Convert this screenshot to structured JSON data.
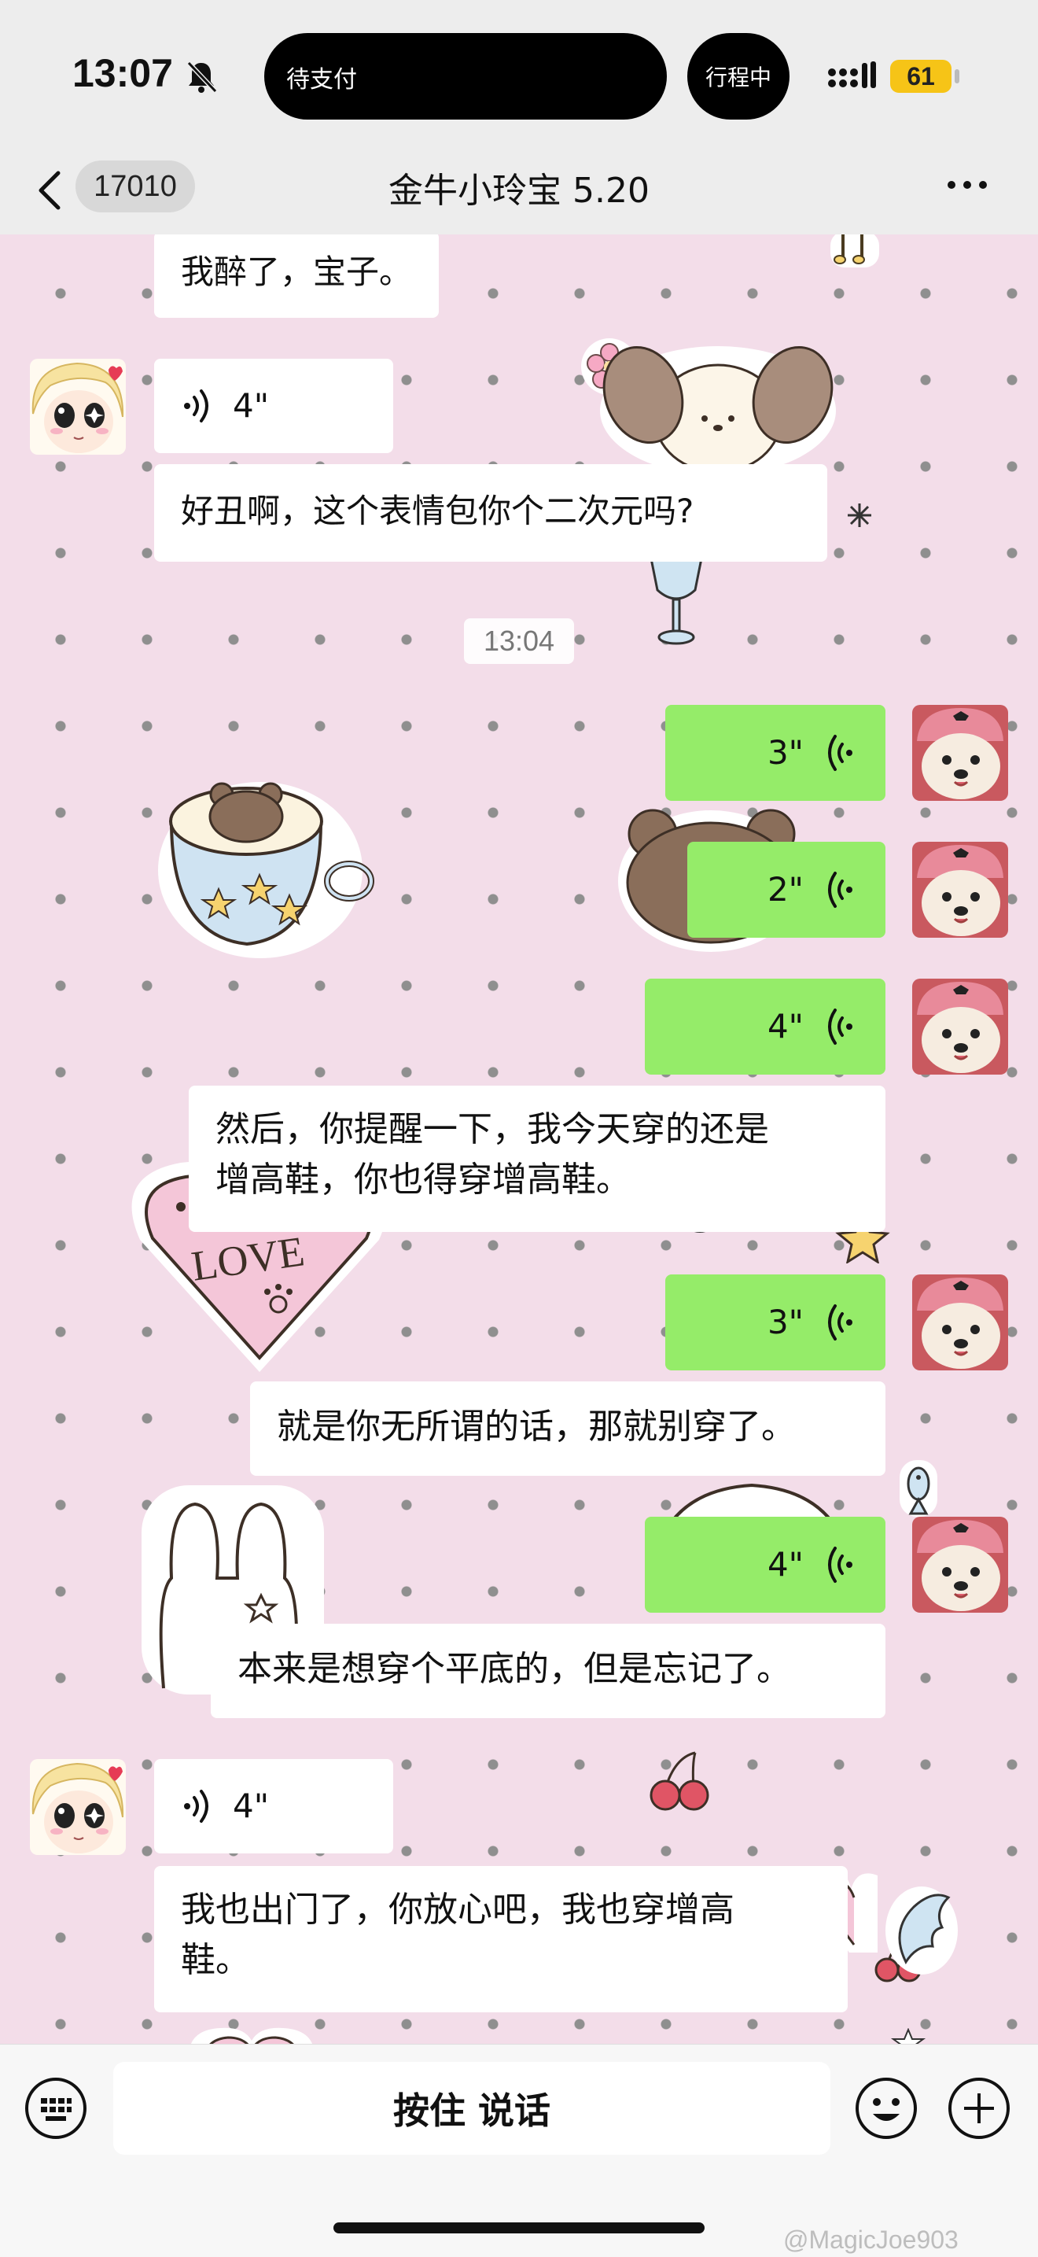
{
  "status_bar": {
    "time": "13:07",
    "pending_label": "待支付",
    "trip_label": "行程中",
    "battery": "61"
  },
  "nav": {
    "unread_count": "17010",
    "title": "金牛小玲宝 5.20"
  },
  "messages": [
    {
      "side": "in",
      "type": "text",
      "text": "我醉了，宝子。"
    },
    {
      "side": "in",
      "type": "voice",
      "duration": "4\""
    },
    {
      "side": "in",
      "type": "text",
      "text": "好丑啊，这个表情包你个二次元吗?"
    },
    {
      "type": "time",
      "text": "13:04"
    },
    {
      "side": "out",
      "type": "voice",
      "duration": "3\""
    },
    {
      "side": "out",
      "type": "voice",
      "duration": "2\""
    },
    {
      "side": "out",
      "type": "voice",
      "duration": "4\""
    },
    {
      "side": "out",
      "type": "text",
      "lines": [
        "然后，你提醒一下，我今天穿的还是",
        "增高鞋，你也得穿增高鞋。"
      ]
    },
    {
      "side": "out",
      "type": "voice",
      "duration": "3\""
    },
    {
      "side": "out",
      "type": "text",
      "text": "就是你无所谓的话，那就别穿了。"
    },
    {
      "side": "out",
      "type": "voice",
      "duration": "4\""
    },
    {
      "side": "out",
      "type": "text",
      "text": "本来是想穿个平底的，但是忘记了。"
    },
    {
      "side": "in",
      "type": "voice",
      "duration": "4\""
    },
    {
      "side": "in",
      "type": "text",
      "lines": [
        "我也出门了，你放心吧，我也穿增高",
        "鞋。"
      ]
    }
  ],
  "stickers": {
    "heart_text": "LOVE"
  },
  "input_bar": {
    "hold_to_talk": "按住 说话"
  },
  "watermark": "@MagicJoe903",
  "colors": {
    "green_bubble": "#95ec69",
    "chat_background": "#f3dde9",
    "dot": "#8f8f8f"
  }
}
